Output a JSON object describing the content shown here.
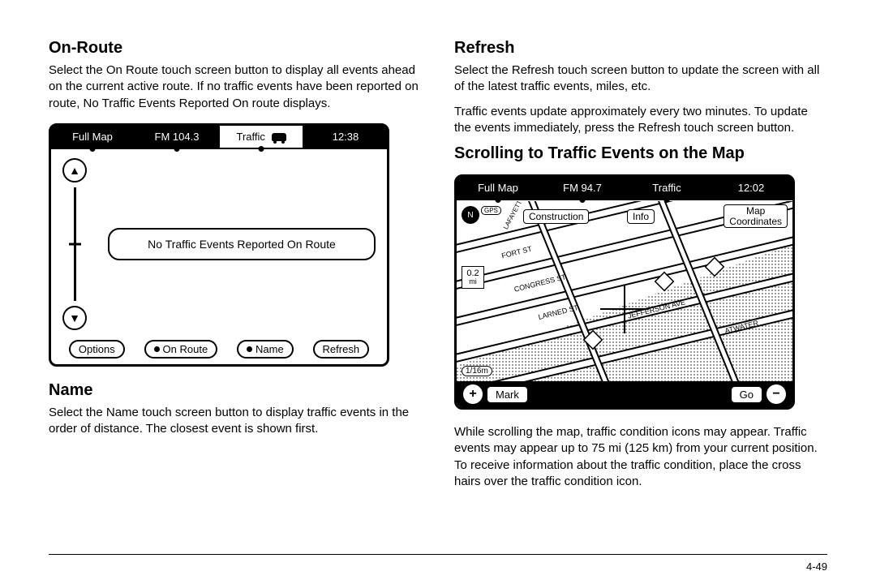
{
  "page_number": "4-49",
  "left": {
    "h_onroute": "On-Route",
    "p_onroute": "Select the On Route touch screen button to display all events ahead on the current active route. If no traffic events have been reported on route, No Traffic Events Reported On route displays.",
    "h_name": "Name",
    "p_name": "Select the Name touch screen button to display traffic events in the order of distance. The closest event is shown first."
  },
  "right": {
    "h_refresh": "Refresh",
    "p_refresh1": "Select the Refresh touch screen button to update the screen with all of the latest traffic events, miles, etc.",
    "p_refresh2": "Traffic events update approximately every two minutes. To update the events immediately, press the Refresh touch screen button.",
    "h_scroll": "Scrolling to Traffic Events on the Map",
    "p_scroll": "While scrolling the map, traffic condition icons may appear. Traffic events may appear up to 75 mi (125 km) from your current position. To receive information about the traffic condition, place the cross hairs over the traffic condition icon."
  },
  "screen1": {
    "tabs": {
      "fullmap": "Full Map",
      "radio": "FM 104.3",
      "traffic": "Traffic",
      "time": "12:38"
    },
    "message": "No Traffic Events Reported On Route",
    "buttons": {
      "options": "Options",
      "onroute": "On Route",
      "name": "Name",
      "refresh": "Refresh"
    }
  },
  "screen2": {
    "tabs": {
      "fullmap": "Full Map",
      "radio": "FM 94.7",
      "traffic": "Traffic",
      "time": "12:02"
    },
    "compass": "N",
    "gps": "GPS",
    "event": "Construction",
    "info": "Info",
    "mapcoords_l1": "Map",
    "mapcoords_l2": "Coordinates",
    "zoom_val": "0.2",
    "zoom_unit": "mi",
    "scale": "1/16m",
    "mark": "Mark",
    "go": "Go",
    "streets": {
      "lafayette": "LAFAYETTE",
      "fort": "FORT ST",
      "congress": "CONGRESS ST",
      "larned": "LARNED ST",
      "jefferson": "JEFFERSON AVE",
      "atwater": "ATWATER"
    }
  }
}
